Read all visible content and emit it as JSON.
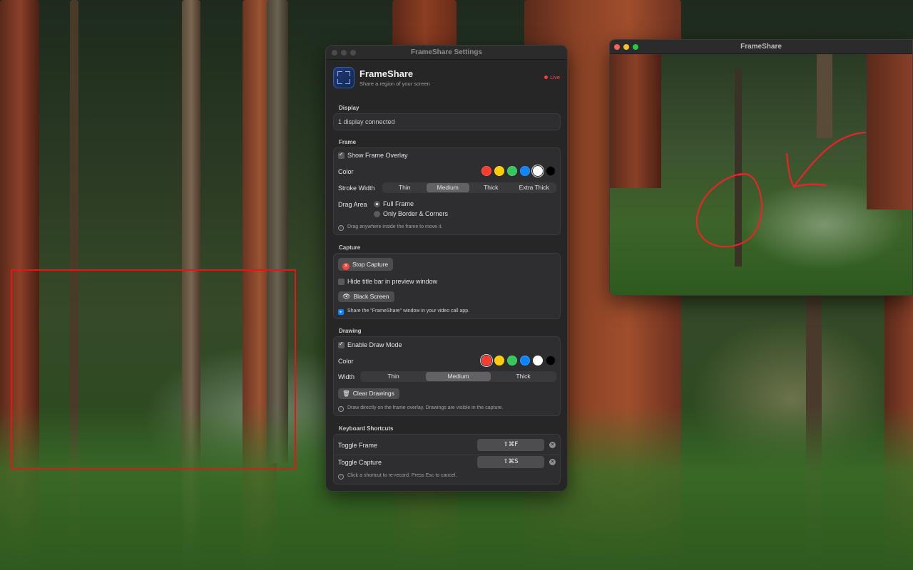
{
  "settings_window": {
    "title": "FrameShare Settings",
    "app_name": "FrameShare",
    "app_subtitle": "Share a region of your screen",
    "live_label": "Live",
    "display": {
      "section": "Display",
      "status": "1 display connected"
    },
    "frame": {
      "section": "Frame",
      "show_overlay_label": "Show Frame Overlay",
      "show_overlay_checked": true,
      "color_label": "Color",
      "colors": [
        "#ff3b30",
        "#ffcc00",
        "#34c759",
        "#0a84ff",
        "#ffffff",
        "#000000"
      ],
      "selected_color": "#ffffff",
      "stroke_label": "Stroke Width",
      "stroke_options": [
        "Thin",
        "Medium",
        "Thick",
        "Extra Thick"
      ],
      "stroke_selected": "Medium",
      "drag_label": "Drag Area",
      "drag_options": [
        "Full Frame",
        "Only Border & Corners"
      ],
      "drag_selected": "Full Frame",
      "hint": "Drag anywhere inside the frame to move it."
    },
    "capture": {
      "section": "Capture",
      "stop_label": "Stop Capture",
      "hide_titlebar_label": "Hide title bar in preview window",
      "hide_titlebar_checked": false,
      "black_screen_label": "Black Screen",
      "hint": "Share the \"FrameShare\" window in your video call app."
    },
    "drawing": {
      "section": "Drawing",
      "enable_label": "Enable Draw Mode",
      "enable_checked": true,
      "color_label": "Color",
      "colors": [
        "#ff3b30",
        "#ffcc00",
        "#34c759",
        "#0a84ff",
        "#ffffff",
        "#000000"
      ],
      "selected_color": "#ff3b30",
      "width_label": "Width",
      "width_options": [
        "Thin",
        "Medium",
        "Thick"
      ],
      "width_selected": "Medium",
      "clear_label": "Clear Drawings",
      "hint": "Draw directly on the frame overlay. Drawings are visible in the capture."
    },
    "shortcuts": {
      "section": "Keyboard Shortcuts",
      "items": [
        {
          "label": "Toggle Frame",
          "keys": "⇧⌘F"
        },
        {
          "label": "Toggle Capture",
          "keys": "⇧⌘S"
        }
      ],
      "hint": "Click a shortcut to re-record. Press Esc to cancel."
    }
  },
  "preview_window": {
    "title": "FrameShare"
  },
  "overlay": {
    "frame_color": "#e01818"
  }
}
